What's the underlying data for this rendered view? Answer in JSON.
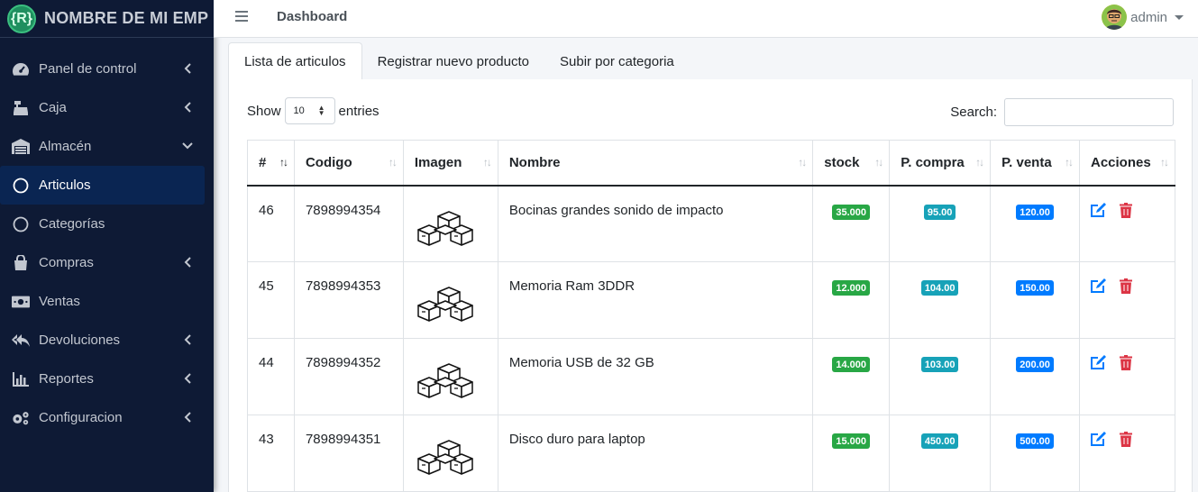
{
  "brand": {
    "logo_text": "{R}",
    "name": "NOMBRE DE MI EMP"
  },
  "sidebar": {
    "items": [
      {
        "label": "Panel de control",
        "icon": "tachometer-icon",
        "arrow": "left"
      },
      {
        "label": "Caja",
        "icon": "cash-register-icon",
        "arrow": "left"
      },
      {
        "label": "Almacén",
        "icon": "warehouse-icon",
        "arrow": "down"
      },
      {
        "label": "Articulos",
        "icon": "circle-icon",
        "arrow": "",
        "active": true
      },
      {
        "label": "Categorías",
        "icon": "circle-icon",
        "arrow": ""
      },
      {
        "label": "Compras",
        "icon": "shopping-bag-icon",
        "arrow": "left"
      },
      {
        "label": "Ventas",
        "icon": "money-bill-icon",
        "arrow": ""
      },
      {
        "label": "Devoluciones",
        "icon": "reply-all-icon",
        "arrow": "left"
      },
      {
        "label": "Reportes",
        "icon": "chart-bar-icon",
        "arrow": "left"
      },
      {
        "label": "Configuracion",
        "icon": "cogs-icon",
        "arrow": "left"
      }
    ]
  },
  "topbar": {
    "title": "Dashboard",
    "user": "admin"
  },
  "tabs": [
    {
      "label": "Lista de articulos",
      "active": true
    },
    {
      "label": "Registrar nuevo producto"
    },
    {
      "label": "Subir por categoria"
    }
  ],
  "table_controls": {
    "show_label": "Show",
    "entries_value": "10",
    "entries_label": "entries",
    "search_label": "Search:"
  },
  "table": {
    "columns": [
      "#",
      "Codigo",
      "Imagen",
      "Nombre",
      "stock",
      "P. compra",
      "P. venta",
      "Acciones"
    ],
    "rows": [
      {
        "id": "46",
        "codigo": "7898994354",
        "nombre": "Bocinas grandes sonido de impacto",
        "stock": "35.000",
        "compra": "95.00",
        "venta": "120.00"
      },
      {
        "id": "45",
        "codigo": "7898994353",
        "nombre": "Memoria Ram 3DDR",
        "stock": "12.000",
        "compra": "104.00",
        "venta": "150.00"
      },
      {
        "id": "44",
        "codigo": "7898994352",
        "nombre": "Memoria USB de 32 GB",
        "stock": "14.000",
        "compra": "103.00",
        "venta": "200.00"
      },
      {
        "id": "43",
        "codigo": "7898994351",
        "nombre": "Disco duro para laptop",
        "stock": "15.000",
        "compra": "450.00",
        "venta": "500.00"
      }
    ]
  },
  "colors": {
    "sidebar_bg": "#0e1a35",
    "stock_badge": "#28a745",
    "compra_badge": "#17a2b8",
    "venta_badge": "#007bff",
    "edit_icon": "#007bff",
    "delete_icon": "#dc3545"
  }
}
